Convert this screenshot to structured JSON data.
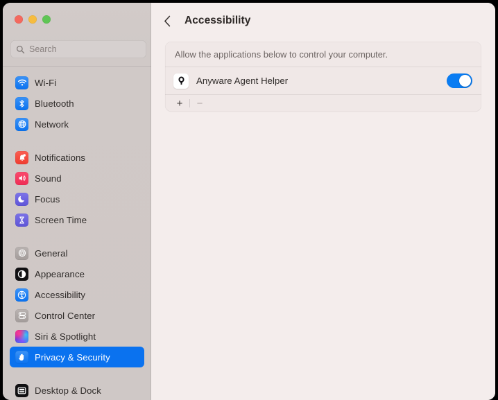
{
  "window": {
    "traffic_lights": [
      {
        "name": "close",
        "color": "#f4695e"
      },
      {
        "name": "minimize",
        "color": "#f6bc3f"
      },
      {
        "name": "maximize",
        "color": "#5fc554"
      }
    ]
  },
  "sidebar": {
    "search": {
      "placeholder": "Search",
      "value": "",
      "icon": "search-icon"
    },
    "groups": [
      {
        "items": [
          {
            "label": "Wi-Fi",
            "icon": "wifi-icon",
            "icon_color": "#0a72ef",
            "selected": false
          },
          {
            "label": "Bluetooth",
            "icon": "bluetooth-icon",
            "icon_color": "#0a72ef",
            "selected": false
          },
          {
            "label": "Network",
            "icon": "network-globe-icon",
            "icon_color": "#0a72ef",
            "selected": false
          }
        ]
      },
      {
        "items": [
          {
            "label": "Notifications",
            "icon": "bell-icon",
            "icon_color": "#ef3b2f",
            "selected": false
          },
          {
            "label": "Sound",
            "icon": "speaker-icon",
            "icon_color": "#ef2d55",
            "selected": false
          },
          {
            "label": "Focus",
            "icon": "moon-icon",
            "icon_color": "#5f55d8",
            "selected": false
          },
          {
            "label": "Screen Time",
            "icon": "hourglass-icon",
            "icon_color": "#5e55d6",
            "selected": false
          }
        ]
      },
      {
        "items": [
          {
            "label": "General",
            "icon": "gear-icon",
            "icon_color": "#a39c9a",
            "selected": false
          },
          {
            "label": "Appearance",
            "icon": "appearance-contrast-icon",
            "icon_color": "#111012",
            "selected": false
          },
          {
            "label": "Accessibility",
            "icon": "accessibility-person-icon",
            "icon_color": "#0a72ef",
            "selected": false
          },
          {
            "label": "Control Center",
            "icon": "control-center-icon",
            "icon_color": "#a39c9a",
            "selected": false
          },
          {
            "label": "Siri & Spotlight",
            "icon": "siri-orb-icon",
            "icon_color": "#6a2fe0",
            "selected": false
          },
          {
            "label": "Privacy & Security",
            "icon": "hand-icon",
            "icon_color": "#0a72ef",
            "selected": true
          }
        ]
      },
      {
        "items": [
          {
            "label": "Desktop & Dock",
            "icon": "desktop-dock-icon",
            "icon_color": "#111012",
            "selected": false
          }
        ]
      }
    ],
    "selected_item": "Privacy & Security",
    "selection_color": "#0a72ef"
  },
  "main": {
    "back_button_icon": "chevron-left-icon",
    "title": "Accessibility",
    "card": {
      "description": "Allow the applications below to control your computer.",
      "apps": [
        {
          "name": "Anyware Agent Helper",
          "icon": "anyware-agent-helper-app-icon",
          "enabled": true,
          "toggle_color": "#0a7cf2"
        }
      ],
      "footer": {
        "add_label": "+",
        "remove_label": "−",
        "add_enabled": true,
        "remove_enabled": false
      }
    }
  }
}
